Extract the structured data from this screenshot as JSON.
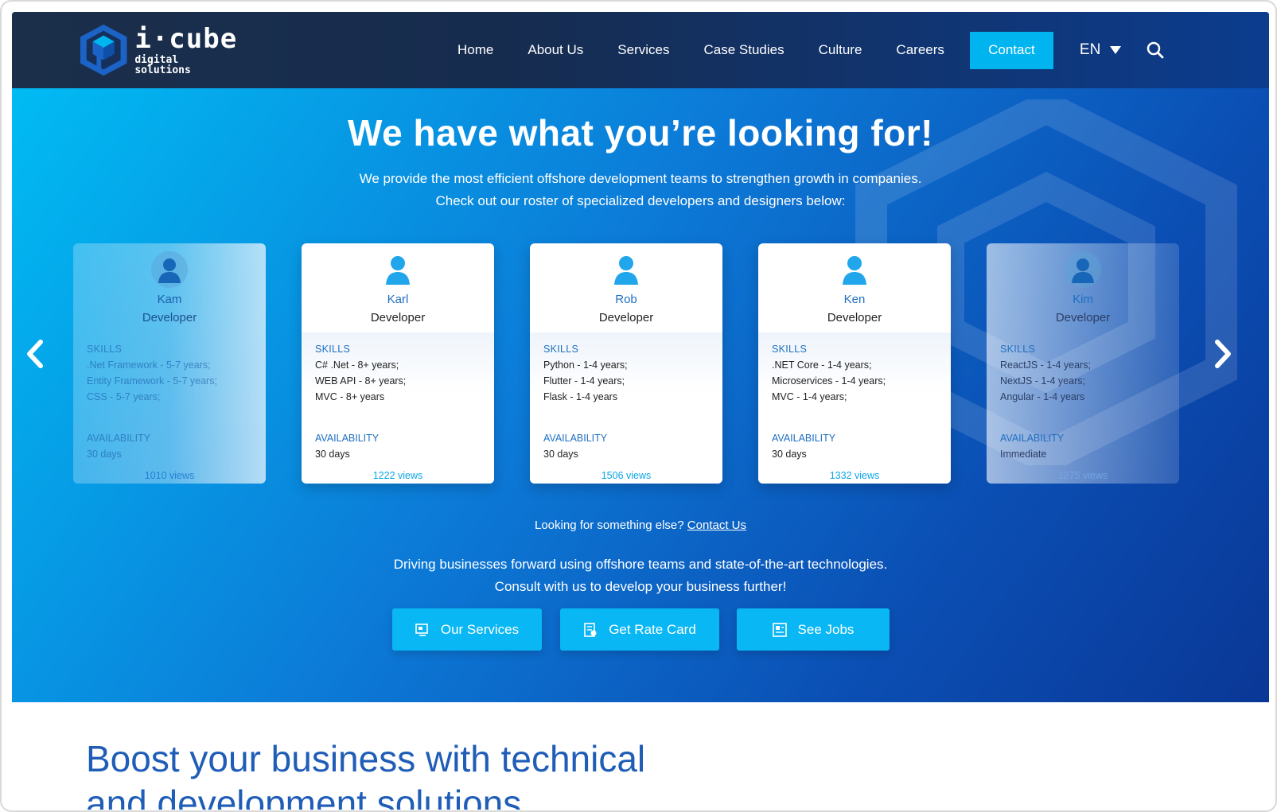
{
  "header": {
    "logo": {
      "name": "i·cube",
      "subtitle": "digital solutions"
    },
    "nav": [
      "Home",
      "About Us",
      "Services",
      "Case Studies",
      "Culture",
      "Careers"
    ],
    "contact_label": "Contact",
    "language": "EN"
  },
  "hero": {
    "title": "We have what you’re looking for!",
    "subtitle_line1": "We provide the most efficient offshore development teams to strengthen growth in companies.",
    "subtitle_line2": "Check out our roster of specialized developers and designers below:"
  },
  "labels": {
    "skills": "SKILLS",
    "availability": "AVAILABILITY"
  },
  "developers": [
    {
      "name": "Kam",
      "role": "Developer",
      "skills": [
        ".Net Framework - 5-7 years;",
        "Entity Framework - 5-7 years;",
        "CSS - 5-7 years;"
      ],
      "availability": "30 days",
      "views": "1010 views"
    },
    {
      "name": "Karl",
      "role": "Developer",
      "skills": [
        "C# .Net - 8+ years;",
        "WEB API - 8+ years;",
        "MVC - 8+ years"
      ],
      "availability": "30 days",
      "views": "1222 views"
    },
    {
      "name": "Rob",
      "role": "Developer",
      "skills": [
        "Python - 1-4 years;",
        "Flutter - 1-4 years;",
        "Flask - 1-4 years"
      ],
      "availability": "30 days",
      "views": "1506 views"
    },
    {
      "name": "Ken",
      "role": "Developer",
      "skills": [
        ".NET Core - 1-4 years;",
        "Microservices - 1-4 years;",
        "MVC - 1-4 years;"
      ],
      "availability": "30 days",
      "views": "1332 views"
    },
    {
      "name": "Kim",
      "role": "Developer",
      "skills": [
        "ReactJS - 1-4 years;",
        "NextJS - 1-4 years;",
        "Angular - 1-4 years"
      ],
      "availability": "Immediate",
      "views": "1275 views"
    }
  ],
  "looking": {
    "text": "Looking for something else?",
    "link": "Contact Us"
  },
  "driving": {
    "line1": "Driving businesses forward using offshore teams and state-of-the-art technologies.",
    "line2": "Consult with us to develop your business further!"
  },
  "cta": {
    "services": "Our Services",
    "rate_card": "Get Rate Card",
    "jobs": "See Jobs"
  },
  "boost": {
    "line1": "Boost your business with technical",
    "line2": "and development solutions"
  },
  "colors": {
    "accent": "#00b4f0",
    "brand_blue": "#1f5db7",
    "header_bg": "#1b2f4a"
  }
}
